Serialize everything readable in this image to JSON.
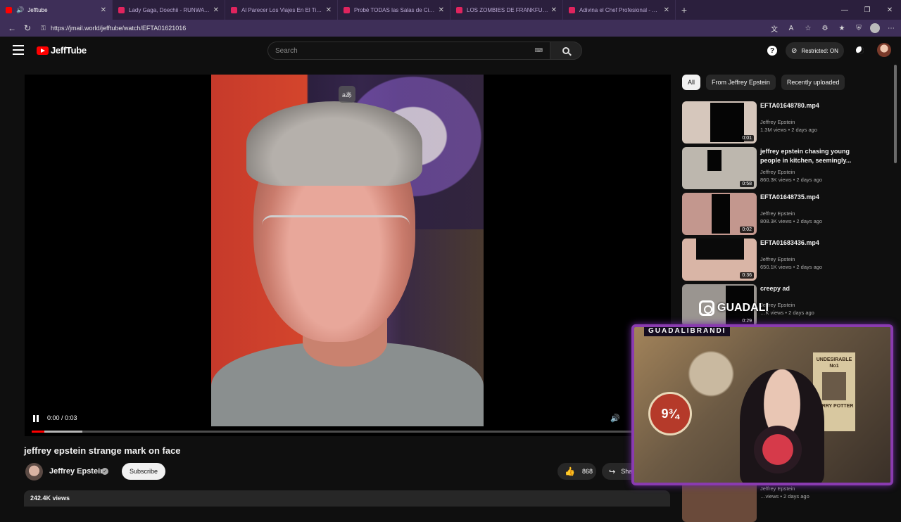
{
  "browser": {
    "tabs": [
      {
        "title": "Jefftube",
        "active": true
      },
      {
        "title": "Lady Gaga, Doechii - RUNWAY (Of",
        "active": false
      },
      {
        "title": "Al Parecer Los Viajes En El Tiempo",
        "active": false
      },
      {
        "title": "Probé TODAS las Salas de Cine en",
        "active": false
      },
      {
        "title": "LOS ZOMBIES DE FRANKFURT (JAN",
        "active": false
      },
      {
        "title": "Adivina el Chef Profesional - YouT",
        "active": false
      }
    ],
    "url": "https://jmail.world/jefftube/watch/EFTA01621016"
  },
  "header": {
    "logo_text": "JeffTube",
    "search_placeholder": "Search",
    "restricted_label": "Restricted: ON"
  },
  "player": {
    "caption_badge": "aあ",
    "time": "0:00 / 0:03",
    "progress_fraction": 0.02,
    "buffer_fraction": 0.08
  },
  "video": {
    "title": "jeffrey epstein strange mark on face",
    "channel": "Jeffrey Epstein",
    "subscribe_label": "Subscribe",
    "likes": "868",
    "share_label": "Share",
    "views": "242.4K views"
  },
  "sidebar": {
    "chips": [
      "All",
      "From Jeffrey Epstein",
      "Recently uploaded"
    ],
    "items": [
      {
        "title": "EFTA01648780.mp4",
        "channel": "Jeffrey Epstein",
        "meta": "1.3M views • 2 days ago",
        "duration": "0:01"
      },
      {
        "title": "jeffrey epstein chasing young people in kitchen, seemingly...",
        "channel": "Jeffrey Epstein",
        "meta": "860.3K views • 2 days ago",
        "duration": "0:58"
      },
      {
        "title": "EFTA01648735.mp4",
        "channel": "Jeffrey Epstein",
        "meta": "808.3K views • 2 days ago",
        "duration": "0:02"
      },
      {
        "title": "EFTA01683436.mp4",
        "channel": "Jeffrey Epstein",
        "meta": "650.1K views • 2 days ago",
        "duration": "0:36"
      },
      {
        "title": "creepy ad",
        "channel": "Jeffrey Epstein",
        "meta": "…K views • 2 days ago",
        "duration": "0:29"
      }
    ],
    "last_item": {
      "channel": "Jeffrey Epstein",
      "meta": "…views • 2 days ago"
    }
  },
  "overlay": {
    "streamer_name": "GUADALIBRANDI",
    "instagram_handle": "GUADALI",
    "wanted_poster_text": "UNDESIRABLE No1",
    "wanted_poster_name": "HARRY POTTER",
    "platform_sign": "9¾"
  }
}
